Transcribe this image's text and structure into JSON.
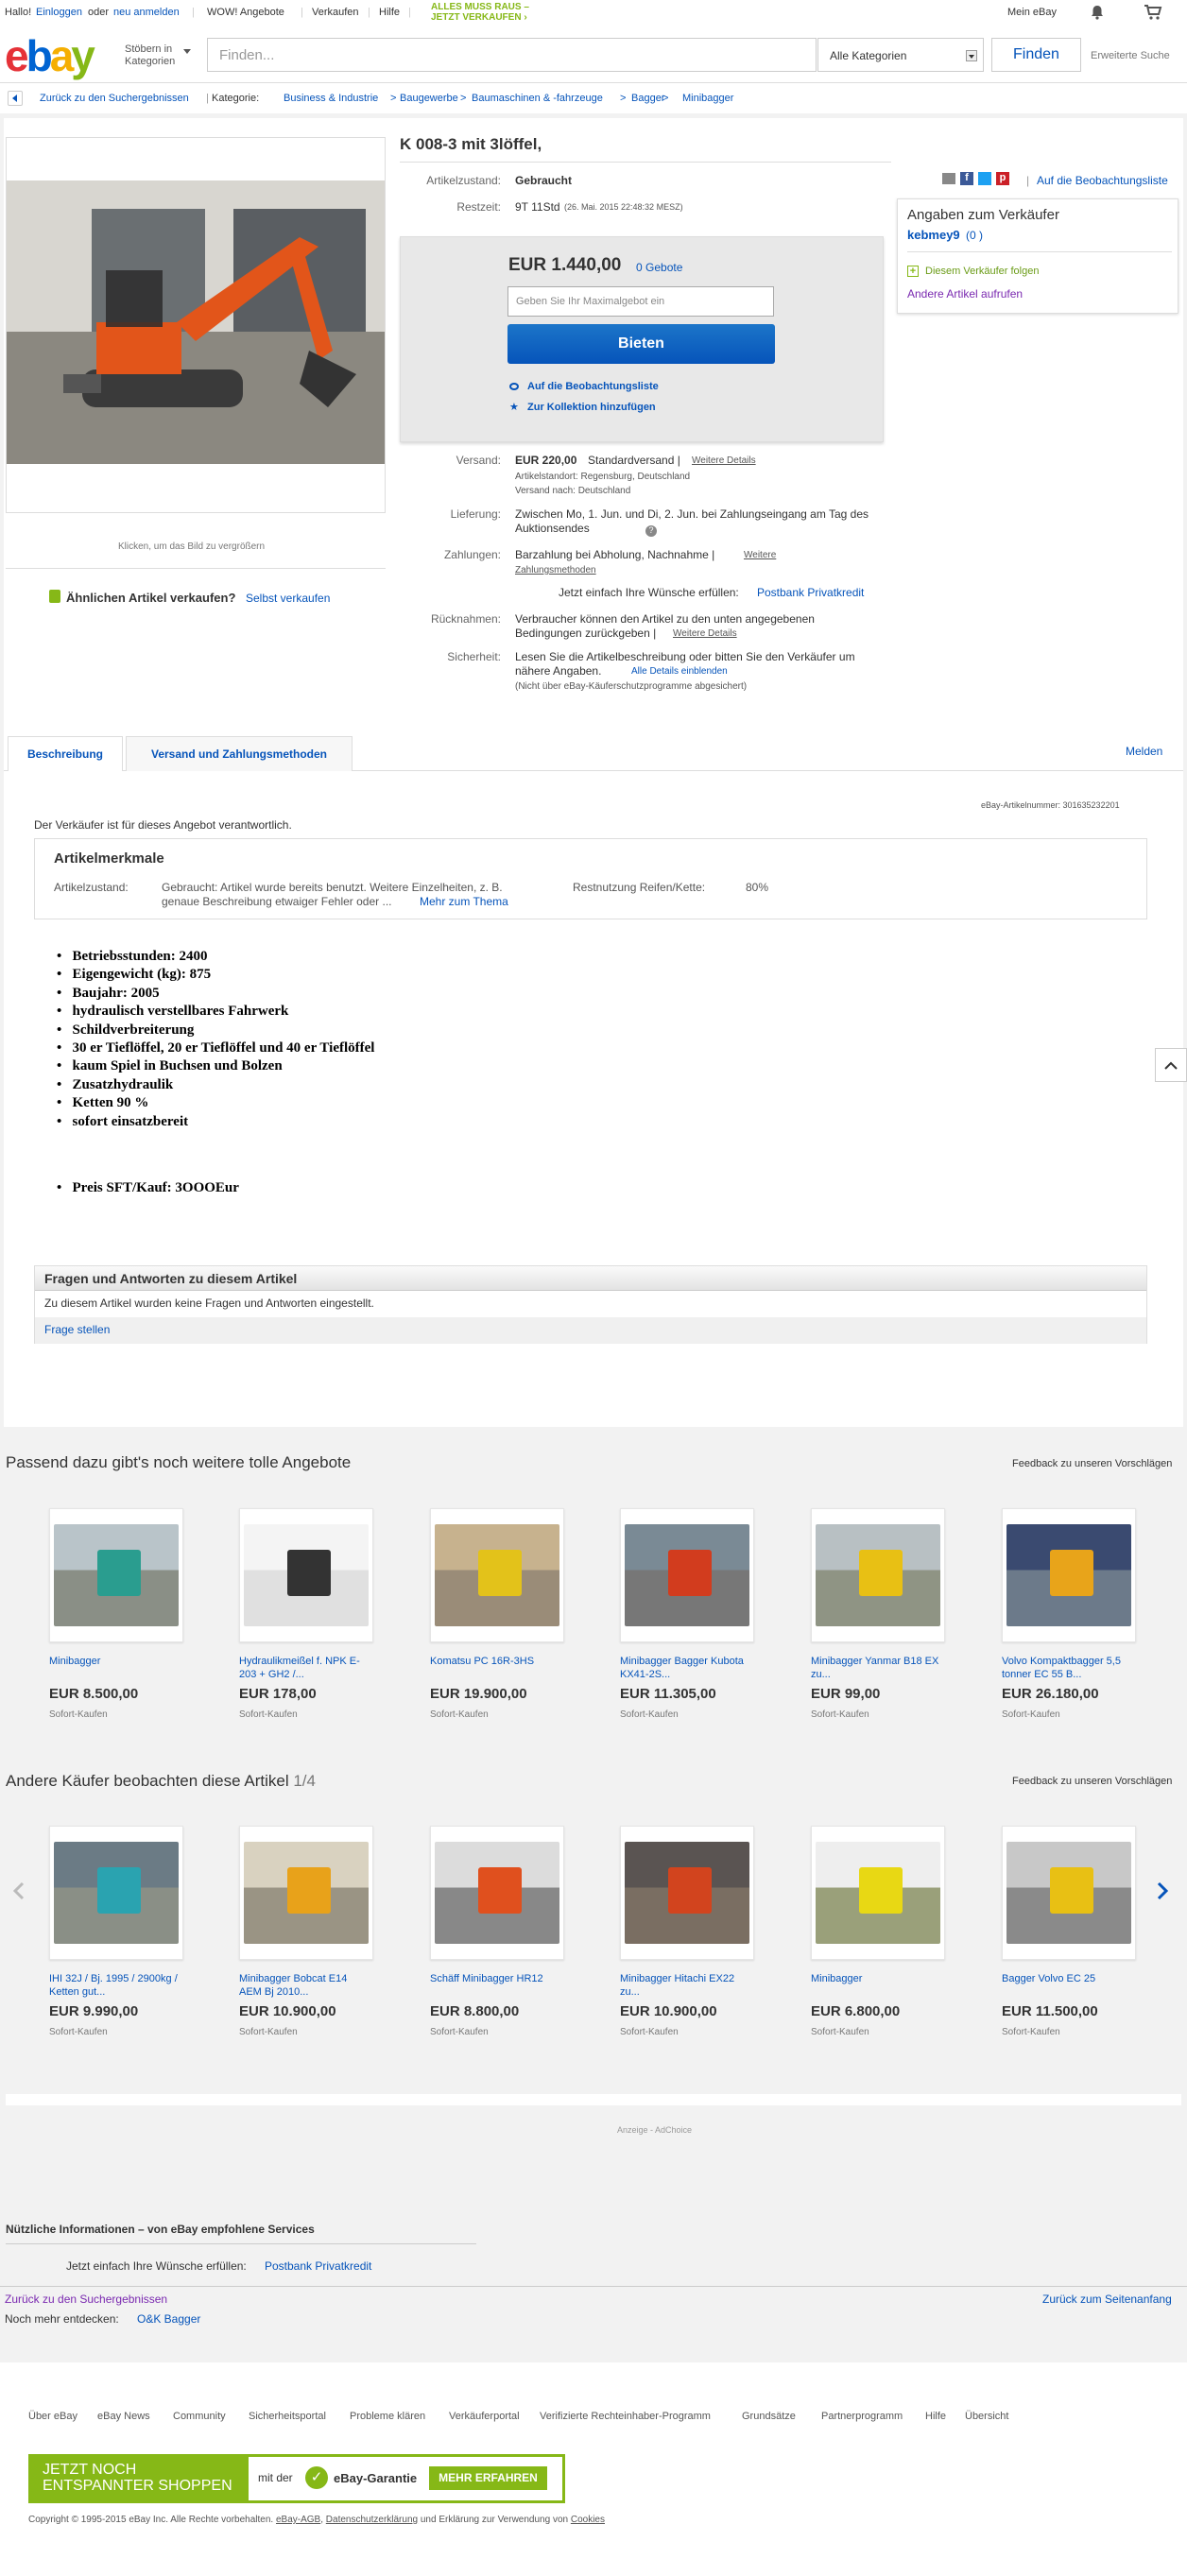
{
  "topbar": {
    "hello": "Hallo!",
    "login": "Einloggen",
    "or": "oder",
    "register": "neu anmelden",
    "wow": "WOW! Angebote",
    "sell": "Verkaufen",
    "help": "Hilfe",
    "promo_line1": "ALLES MUSS RAUS –",
    "promo_line2": "JETZT VERKAUFEN",
    "promo_arrow": "›",
    "my_ebay": "Mein eBay",
    "bell": "bell-icon",
    "cart": "cart-icon"
  },
  "header": {
    "browse_line1": "Stöbern in",
    "browse_line2": "Kategorien",
    "search_placeholder": "Finden...",
    "category": "Alle Kategorien",
    "find": "Finden",
    "advanced": "Erweiterte Suche"
  },
  "breadcrumb": {
    "back": "Zurück zu den Suchergebnissen",
    "sep": "|",
    "cat_label": "Kategorie:",
    "items": [
      "Business & Industrie",
      ">",
      "Baugewerbe",
      ">",
      "Baumaschinen & -fahrzeuge",
      ">",
      "Bagger",
      ">",
      "Minibagger"
    ]
  },
  "image": {
    "caption": "Klicken, um das Bild zu vergrößern"
  },
  "sell_similar": {
    "text": "Ähnlichen Artikel verkaufen?",
    "link": "Selbst verkaufen"
  },
  "item": {
    "title": "K 008-3 mit 3löffel,",
    "condition_label": "Artikelzustand:",
    "condition": "Gebraucht",
    "time_label": "Restzeit:",
    "time": "9T 11Std",
    "time_detail": "(26. Mai. 2015  22:48:32 MESZ)",
    "share_watch": "Auf die Beobachtungsliste",
    "price": "EUR 1.440,00",
    "bids": "0 Gebote",
    "bid_placeholder": "Geben Sie Ihr Maximalgebot ein",
    "bid_button": "Bieten",
    "watch_link": "Auf die Beobachtungsliste",
    "collection_link": "Zur Kollektion hinzufügen",
    "shipping_label": "Versand:",
    "shipping_price": "EUR 220,00",
    "shipping_type": "Standardversand |",
    "shipping_more": "Weitere Details",
    "location": "Artikelstandort:  Regensburg, Deutschland",
    "ships_to": "Versand nach:  Deutschland",
    "delivery_label": "Lieferung:",
    "delivery": "Zwischen Mo, 1. Jun. und Di, 2. Jun. bei Zahlungseingang am Tag des Auktionsendes",
    "payment_label": "Zahlungen:",
    "payment": "Barzahlung bei Abholung,  Nachnahme  |",
    "payment_more": "Weitere Zahlungsmethoden",
    "credit_text": "Jetzt einfach Ihre Wünsche erfüllen:",
    "credit_link": "Postbank Privatkredit",
    "returns_label": "Rücknahmen:",
    "returns": "Verbraucher können den Artikel zu den unten angegebenen Bedingungen zurückgeben |",
    "returns_more": "Weitere Details",
    "safety_label": "Sicherheit:",
    "safety": "Lesen Sie die Artikelbeschreibung oder bitten Sie den Verkäufer um nähere Angaben.",
    "safety_link": "Alle Details einblenden",
    "safety_note": "(Nicht über eBay-Käuferschutzprogramme abgesichert)"
  },
  "seller": {
    "title": "Angaben zum Verkäufer",
    "name": "kebmey9",
    "score": "(0 )",
    "follow": "Diesem Verkäufer folgen",
    "other": "Andere Artikel aufrufen"
  },
  "tabs": {
    "desc": "Beschreibung",
    "ship": "Versand und Zahlungsmethoden",
    "report": "Melden"
  },
  "desc": {
    "responsible": "Der Verkäufer ist für dieses Angebot verantwortlich.",
    "item_number": "eBay-Artikelnummer:   301635232201",
    "features_title": "Artikelmerkmale",
    "cond_label": "Artikelzustand:",
    "cond_text": "Gebraucht: Artikel wurde bereits benutzt. Weitere Einzelheiten, z. B. genaue Beschreibung etwaiger Fehler oder ...",
    "cond_more": "Mehr zum Thema",
    "rest_label": "Restnutzung Reifen/Kette:",
    "rest_value": "80%",
    "bullets": [
      "Betriebsstunden:     2400",
      "Eigengewicht (kg):      875",
      "Baujahr:      2005",
      "hydraulisch verstellbares Fahrwerk",
      "Schildverbreiterung",
      "30 er Tieflöffel, 20 er Tieflöffel und 40 er Tieflöffel",
      "kaum Spiel in Buchsen und Bolzen",
      "Zusatzhydraulik",
      "Ketten 90 %",
      "sofort einsatzbereit"
    ],
    "price_bullet": "Preis SFT/Kauf: 3OOOEur"
  },
  "qa": {
    "title": "Fragen und Antworten zu diesem Artikel",
    "none": "Zu diesem Artikel wurden keine Fragen und Antworten eingestellt.",
    "ask": "Frage stellen"
  },
  "reco1": {
    "title": "Passend dazu gibt's noch weitere tolle Angebote",
    "feedback": "Feedback zu unseren Vorschlägen",
    "items": [
      {
        "title": "Minibagger",
        "price": "EUR 8.500,00",
        "sub": "Sofort-Kaufen"
      },
      {
        "title": "Hydraulikmeißel f. NPK E-203 + GH2 /...",
        "price": "EUR 178,00",
        "sub": "Sofort-Kaufen"
      },
      {
        "title": "Komatsu PC 16R-3HS",
        "price": "EUR 19.900,00",
        "sub": "Sofort-Kaufen"
      },
      {
        "title": "Minibagger Bagger Kubota KX41-2S...",
        "price": "EUR 11.305,00",
        "sub": "Sofort-Kaufen"
      },
      {
        "title": "Minibagger Yanmar B18 EX zu...",
        "price": "EUR 99,00",
        "sub": "Sofort-Kaufen"
      },
      {
        "title": "Volvo Kompaktbagger 5,5 tonner EC 55 B...",
        "price": "EUR 26.180,00",
        "sub": "Sofort-Kaufen"
      }
    ]
  },
  "reco2": {
    "title": "Andere Käufer beobachten diese Artikel",
    "page": "1/4",
    "feedback": "Feedback zu unseren Vorschlägen",
    "items": [
      {
        "title": "IHI 32J / Bj. 1995 / 2900kg / Ketten gut...",
        "price": "EUR 9.990,00",
        "sub": "Sofort-Kaufen"
      },
      {
        "title": "Minibagger Bobcat E14 AEM Bj 2010...",
        "price": "EUR 10.900,00",
        "sub": "Sofort-Kaufen"
      },
      {
        "title": "Schäff Minibagger HR12",
        "price": "EUR 8.800,00",
        "sub": "Sofort-Kaufen"
      },
      {
        "title": "Minibagger Hitachi EX22 zu...",
        "price": "EUR 10.900,00",
        "sub": "Sofort-Kaufen"
      },
      {
        "title": "Minibagger",
        "price": "EUR 6.800,00",
        "sub": "Sofort-Kaufen"
      },
      {
        "title": "Bagger Volvo EC 25",
        "price": "EUR 11.500,00",
        "sub": "Sofort-Kaufen"
      }
    ]
  },
  "ad": {
    "label": "Anzeige - AdChoice"
  },
  "useful": {
    "title": "Nützliche Informationen – von eBay empfohlene Services",
    "text": "Jetzt einfach Ihre Wünsche erfüllen:",
    "link": "Postbank Privatkredit"
  },
  "bottom": {
    "back": "Zurück zu den Suchergebnissen",
    "top": "Zurück zum Seitenanfang",
    "more": "Noch mehr entdecken:",
    "more_link": "O&K Bagger"
  },
  "footer": {
    "links": [
      "Über eBay",
      "eBay News",
      "Community",
      "Sicherheitsportal",
      "Probleme klären",
      "Verkäuferportal",
      "Verifizierte Rechteinhaber-Programm",
      "Grundsätze",
      "Partnerprogramm",
      "Hilfe",
      "Übersicht"
    ],
    "banner_l1": "JETZT NOCH",
    "banner_l2": "ENTSPANNTER SHOPPEN",
    "banner_with": "mit der",
    "banner_guarantee": "eBay-Garantie",
    "banner_btn": "MEHR ERFAHREN",
    "copyright": "Copyright © 1995-2015 eBay Inc. Alle Rechte vorbehalten.",
    "agb": "eBay-AGB",
    "privacy": "Datenschutzerklärung",
    "and": "und Erklärung zur Verwendung von",
    "cookies": "Cookies"
  }
}
